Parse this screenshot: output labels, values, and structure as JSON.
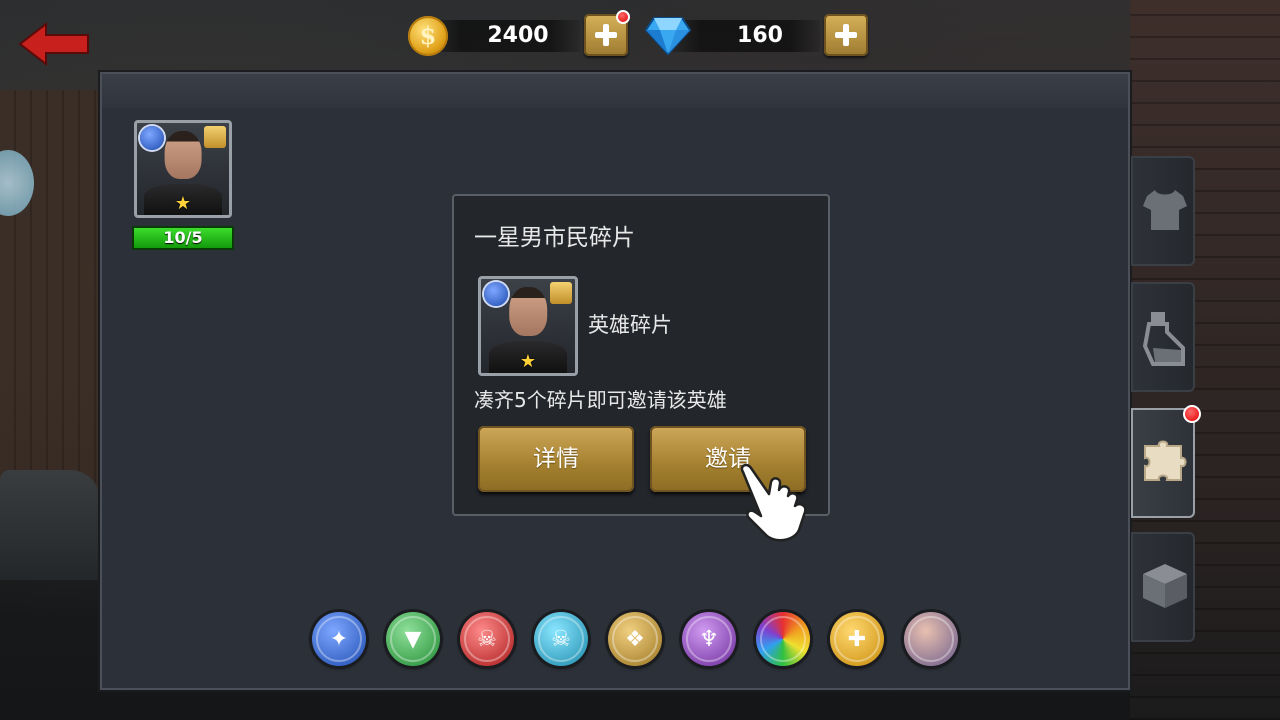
{
  "topbar": {
    "coin_symbol": "$",
    "gold_amount": "2400",
    "diamond_amount": "160",
    "gold_plus_has_notification": true
  },
  "hero_list": [
    {
      "name_icon": "male-citizen-portrait",
      "stars": 1,
      "shard_progress": "10/5"
    }
  ],
  "popup": {
    "title": "一星男市民碎片",
    "item_type": "英雄碎片",
    "description": "凑齐5个碎片即可邀请该英雄",
    "details_button": "详情",
    "invite_button": "邀请"
  },
  "side_tabs": [
    {
      "icon": "shirt-icon",
      "active": false
    },
    {
      "icon": "potion-icon",
      "active": false
    },
    {
      "icon": "puzzle-icon",
      "active": true,
      "notification": true
    },
    {
      "icon": "box-icon",
      "active": false
    }
  ],
  "filters": [
    {
      "icon": "wing-faction-icon",
      "color": "#2f6fd6"
    },
    {
      "icon": "triangle-faction-icon",
      "color": "#2fa84a"
    },
    {
      "icon": "skull-red-faction-icon",
      "color": "#c82a2a"
    },
    {
      "icon": "skull-cyan-faction-icon",
      "color": "#2aa8c8"
    },
    {
      "icon": "eagle-faction-icon",
      "color": "#b8902a"
    },
    {
      "icon": "demon-faction-icon",
      "color": "#8a3ac0"
    },
    {
      "icon": "rainbow-all-icon",
      "color": "#e8a020"
    },
    {
      "icon": "puzzle-filter-icon",
      "color": "#e0a010"
    },
    {
      "icon": "heroes-group-icon",
      "color": "#9a8ab0"
    }
  ]
}
